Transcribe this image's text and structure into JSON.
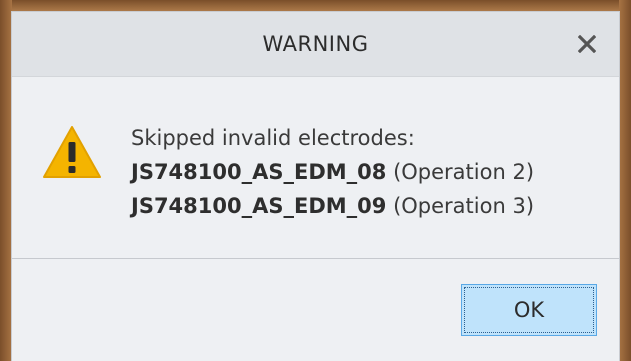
{
  "dialog": {
    "title": "WARNING",
    "close_icon": "close-icon",
    "warning_icon": "warning-triangle-icon",
    "message": {
      "heading": "Skipped invalid electrodes:",
      "items": [
        {
          "name": "JS748100_AS_EDM_08",
          "operation": "(Operation 2)"
        },
        {
          "name": "JS748100_AS_EDM_09",
          "operation": "(Operation 3)"
        }
      ]
    },
    "ok_label": "OK"
  },
  "colors": {
    "titlebar": "#dfe2e6",
    "body": "#eef0f3",
    "warning_yellow": "#f4b400",
    "ok_button": "#bfe3fb",
    "ok_border": "#59a8e6"
  }
}
